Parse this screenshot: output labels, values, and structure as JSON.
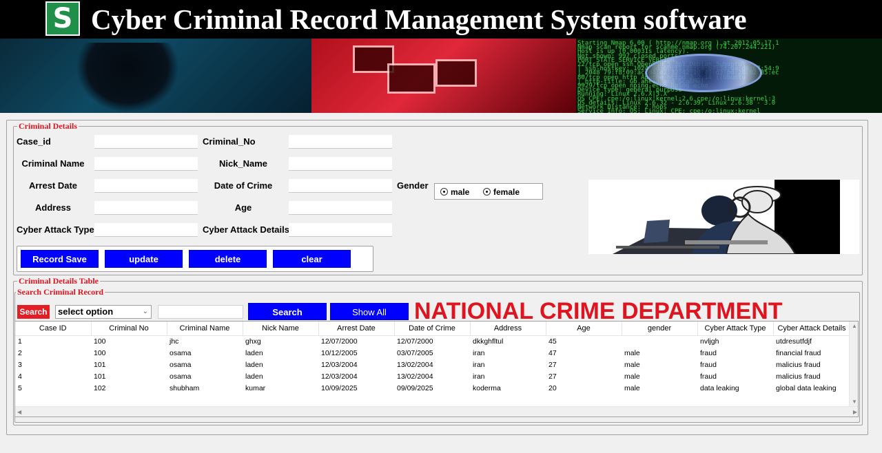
{
  "header": {
    "title": "Cyber Criminal Record Management System software",
    "logo_letter": "S"
  },
  "banner": {
    "terminal_lines": [
      "Starting Nmap 6.00 ( http://nmap.org ) at 2012-05-17 1",
      "Nmap scan report for scanme.nmap.org (74.207.244.221)",
      "Host is up (0.00031s latency).",
      "Not shown: 997 closed ports",
      "PORT     STATE SERVICE VERSION",
      "22/tcp   open  ssh     OpenSSH 5.3p1 Debian 3ubuntu",
      "| ssh-hostkey: 1024 8d:60:f1:7c:ca:b7:3d:0a:d6:67:54:9",
      "|_2048 79:f8:09:ac:d4:e2:32:42:10:49:d3:bd:20:82:85:ec",
      "80/tcp   open  http    Apache httpd 2.2.14 ((Ubuntu",
      "|_http-title: Go ahead and ScanMe!",
      "9929/tcp open  nping-echo Nping echo",
      "Device type: general purpose",
      "Running: Linux 2.6.X|3.X",
      "OS CPE: cpe:/o:linux:kernel:2.6 cpe:/o:linux:kernel:3",
      "OS details: Linux 2.6.32 - 2.6.39, Linux 2.6.38 - 3.0",
      "Network Distance: 2 hops",
      "Service Info: OS: Linux; CPE: cpe:/o:linux:kernel"
    ]
  },
  "criminal_details": {
    "legend": "Criminal Details",
    "labels": {
      "case_id": "Case_id",
      "criminal_no": "Criminal_No",
      "criminal_name": "Criminal Name",
      "nick_name": "Nick_Name",
      "arrest_date": "Arrest Date",
      "date_of_crime": "Date of Crime",
      "gender": "Gender",
      "address": "Address",
      "age": "Age",
      "cyber_attack_type": "Cyber Attack Type",
      "cyber_attack_details": "Cyber Attack Details"
    },
    "values": {
      "case_id": "",
      "criminal_no": "",
      "criminal_name": "",
      "nick_name": "",
      "arrest_date": "",
      "date_of_crime": "",
      "address": "",
      "age": "",
      "cyber_attack_type": "",
      "cyber_attack_details": ""
    },
    "gender_options": {
      "male": "male",
      "female": "female"
    },
    "buttons": {
      "save": "Record Save",
      "update": "update",
      "delete": "delete",
      "clear": "clear"
    }
  },
  "table_section": {
    "legend": "Criminal Details Table",
    "search_legend": "Search Criminal Record",
    "search_tag": "Search",
    "select_value": "select option",
    "search_value": "",
    "search_button": "Search",
    "show_all_button": "Show All",
    "banner_text": "NATIONAL CRIME DEPARTMENT",
    "columns": [
      "Case ID",
      "Criminal No",
      "Criminal Name",
      "Nick Name",
      "Arrest Date",
      "Date of Crime",
      "Address",
      "Age",
      "gender",
      "Cyber Attack Type",
      "Cyber Attack Details"
    ],
    "rows": [
      [
        "1",
        "100",
        "jhc",
        "ghxg",
        "12/07/2000",
        "12/07/2000",
        "dkkghfltul",
        "45",
        "",
        "nvljgh",
        "utdresutfdjf"
      ],
      [
        "2",
        "100",
        "osama",
        "laden",
        "10/12/2005",
        "03/07/2005",
        "iran",
        "47",
        "male",
        "fraud",
        "financial fraud"
      ],
      [
        "3",
        "101",
        "osama",
        "laden",
        "12/03/2004",
        "13/02/2004",
        "iran",
        "27",
        "male",
        "fraud",
        "malicius fraud"
      ],
      [
        "4",
        "101",
        "osama",
        "laden",
        "12/03/2004",
        "13/02/2004",
        "iran",
        "27",
        "male",
        "fraud",
        "malicius fraud"
      ],
      [
        "5",
        "102",
        "shubham",
        "kumar",
        "10/09/2025",
        "09/09/2025",
        "koderma",
        "20",
        "male",
        "data leaking",
        "global data leaking"
      ]
    ]
  }
}
